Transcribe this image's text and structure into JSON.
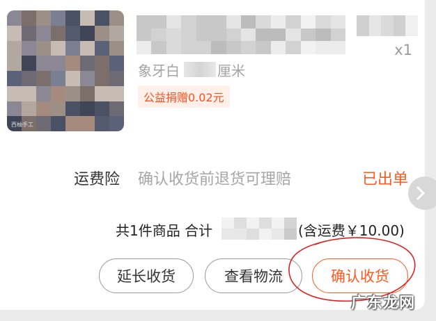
{
  "order": {
    "quantity": "x1",
    "spec_prefix": "象牙白",
    "spec_suffix": "厘米",
    "charity_badge": "公益捐赠0.02元",
    "thumb_tag": "西柚手工"
  },
  "insurance": {
    "label": "运费险",
    "description": "确认收货前退货可理赔",
    "status": "已出单"
  },
  "summary": {
    "prefix": "共1件商品  合计",
    "suffix": "(含运费￥10.00)"
  },
  "actions": {
    "extend_label": "延长收货",
    "logistics_label": "查看物流",
    "confirm_label": "确认收货"
  },
  "watermark": "广东龙网",
  "colors": {
    "accent": "#ff5a1f",
    "annotation": "#e02020"
  },
  "icons": {
    "next": "chevron-right-icon"
  }
}
